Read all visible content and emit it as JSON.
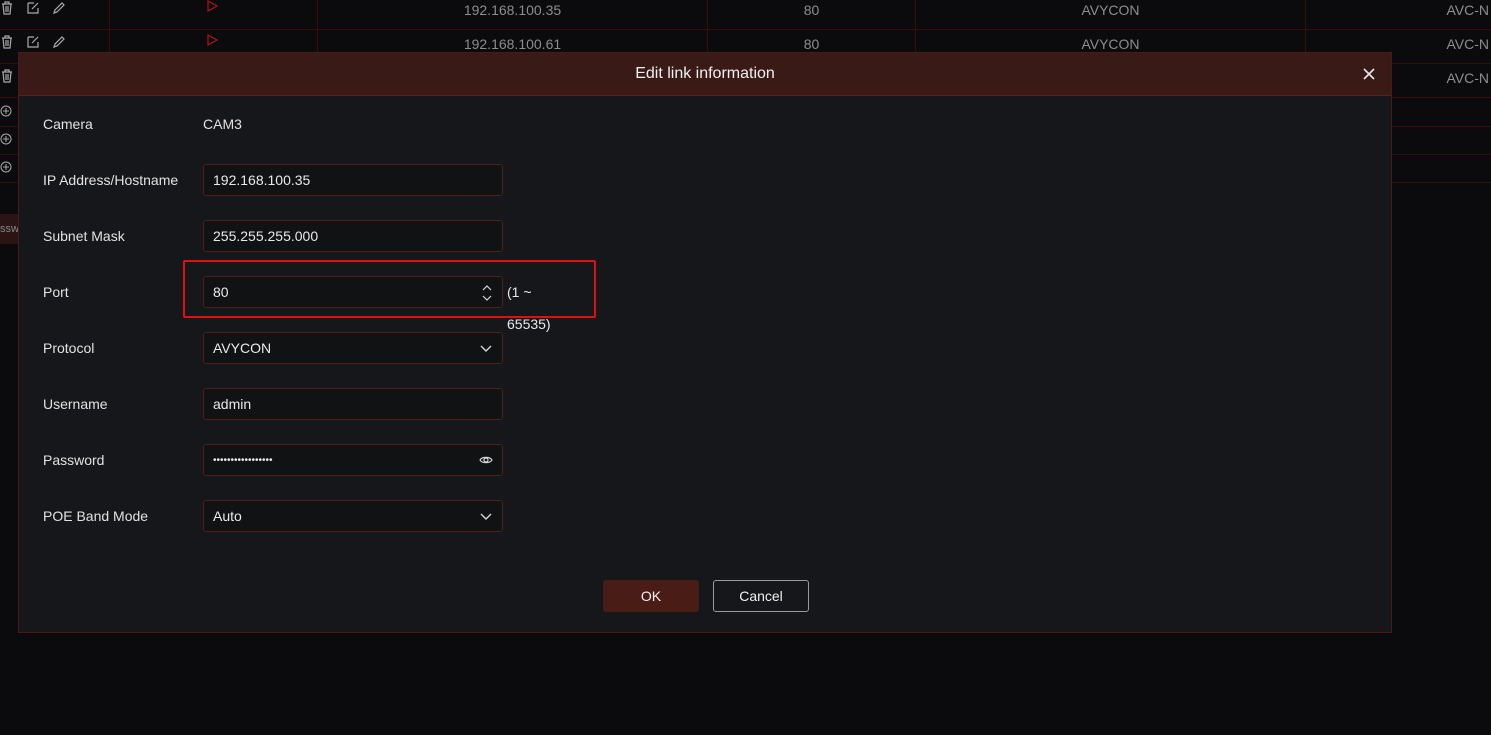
{
  "table": {
    "rows": [
      {
        "ip": "192.168.100.35",
        "port": "80",
        "protocol": "AVYCON",
        "model": "AVC-N"
      },
      {
        "ip": "192.168.100.61",
        "port": "80",
        "protocol": "AVYCON",
        "model": "AVC-N"
      },
      {
        "ip": "",
        "port": "",
        "protocol": "",
        "model": "AVC-N"
      }
    ],
    "side_tab_label": "ssw"
  },
  "dialog": {
    "title": "Edit link information",
    "fields": {
      "camera_label": "Camera",
      "camera_value": "CAM3",
      "ip_label": "IP Address/Hostname",
      "ip_value": "192.168.100.35",
      "subnet_label": "Subnet Mask",
      "subnet_value": "255.255.255.000",
      "port_label": "Port",
      "port_value": "80",
      "port_range": "(1 ~ 65535)",
      "protocol_label": "Protocol",
      "protocol_value": "AVYCON",
      "username_label": "Username",
      "username_value": "admin",
      "password_label": "Password",
      "password_value": "•••••••••••••••••",
      "poe_label": "POE Band Mode",
      "poe_value": "Auto"
    },
    "buttons": {
      "ok": "OK",
      "cancel": "Cancel"
    }
  },
  "icons": [
    "trash-icon",
    "edit-icon",
    "pencil-icon",
    "play-icon",
    "plus-circle-icon",
    "close-icon",
    "stepper-icon",
    "chevron-down-icon",
    "eye-icon"
  ],
  "colors": {
    "accent": "#4a1c16",
    "highlight": "#e01010",
    "header": "#3a1a17"
  }
}
